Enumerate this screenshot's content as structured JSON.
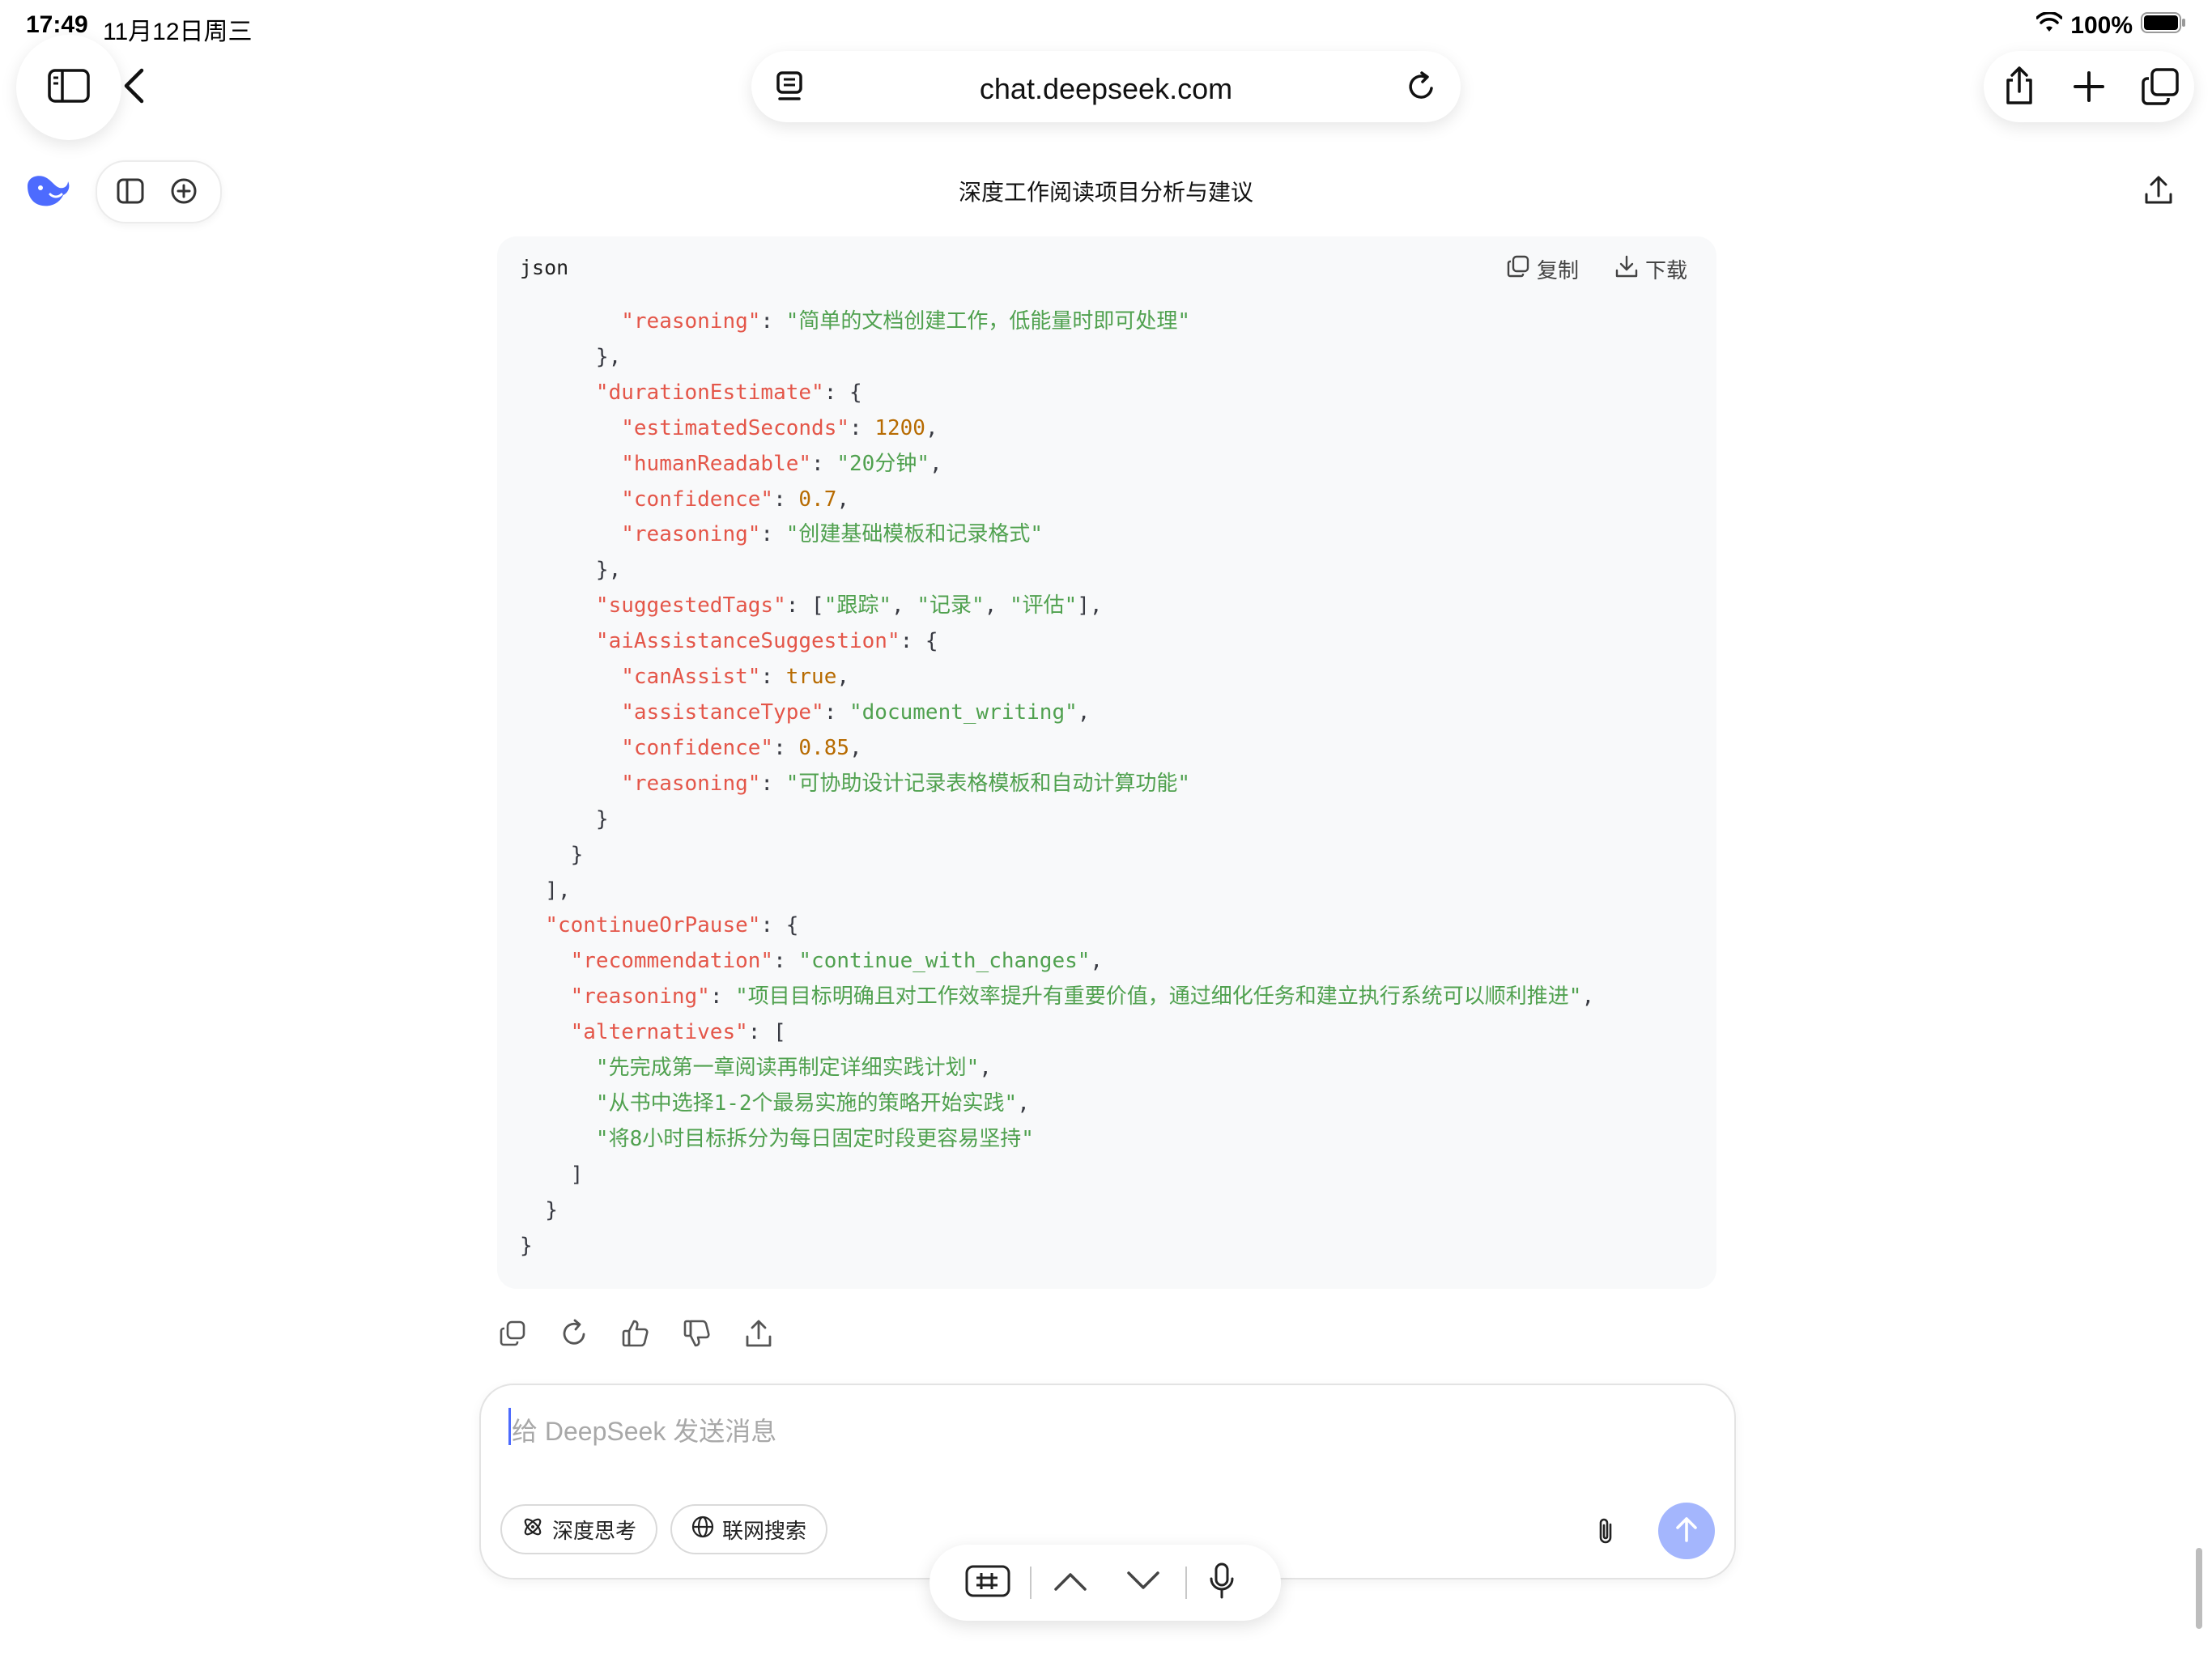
{
  "status_bar": {
    "time": "17:49",
    "date": "11月12日周三",
    "battery": "100%"
  },
  "browser": {
    "url": "chat.deepseek.com"
  },
  "chat": {
    "title": "深度工作阅读项目分析与建议"
  },
  "code_block": {
    "language": "json",
    "copy_label": "复制",
    "download_label": "下载",
    "lines": [
      [
        [
          "        ",
          "p"
        ],
        [
          "\"reasoning\"",
          "k"
        ],
        [
          ": ",
          "p"
        ],
        [
          "\"简单的文档创建工作，低能量时即可处理\"",
          "s"
        ]
      ],
      [
        [
          "      },",
          "p"
        ]
      ],
      [
        [
          "      ",
          "p"
        ],
        [
          "\"durationEstimate\"",
          "k"
        ],
        [
          ": {",
          "p"
        ]
      ],
      [
        [
          "        ",
          "p"
        ],
        [
          "\"estimatedSeconds\"",
          "k"
        ],
        [
          ": ",
          "p"
        ],
        [
          "1200",
          "n"
        ],
        [
          ",",
          "p"
        ]
      ],
      [
        [
          "        ",
          "p"
        ],
        [
          "\"humanReadable\"",
          "k"
        ],
        [
          ": ",
          "p"
        ],
        [
          "\"20分钟\"",
          "s"
        ],
        [
          ",",
          "p"
        ]
      ],
      [
        [
          "        ",
          "p"
        ],
        [
          "\"confidence\"",
          "k"
        ],
        [
          ": ",
          "p"
        ],
        [
          "0.7",
          "n"
        ],
        [
          ",",
          "p"
        ]
      ],
      [
        [
          "        ",
          "p"
        ],
        [
          "\"reasoning\"",
          "k"
        ],
        [
          ": ",
          "p"
        ],
        [
          "\"创建基础模板和记录格式\"",
          "s"
        ]
      ],
      [
        [
          "      },",
          "p"
        ]
      ],
      [
        [
          "      ",
          "p"
        ],
        [
          "\"suggestedTags\"",
          "k"
        ],
        [
          ": [",
          "p"
        ],
        [
          "\"跟踪\"",
          "s"
        ],
        [
          ", ",
          "p"
        ],
        [
          "\"记录\"",
          "s"
        ],
        [
          ", ",
          "p"
        ],
        [
          "\"评估\"",
          "s"
        ],
        [
          "],",
          "p"
        ]
      ],
      [
        [
          "      ",
          "p"
        ],
        [
          "\"aiAssistanceSuggestion\"",
          "k"
        ],
        [
          ": {",
          "p"
        ]
      ],
      [
        [
          "        ",
          "p"
        ],
        [
          "\"canAssist\"",
          "k"
        ],
        [
          ": ",
          "p"
        ],
        [
          "true",
          "n"
        ],
        [
          ",",
          "p"
        ]
      ],
      [
        [
          "        ",
          "p"
        ],
        [
          "\"assistanceType\"",
          "k"
        ],
        [
          ": ",
          "p"
        ],
        [
          "\"document_writing\"",
          "s"
        ],
        [
          ",",
          "p"
        ]
      ],
      [
        [
          "        ",
          "p"
        ],
        [
          "\"confidence\"",
          "k"
        ],
        [
          ": ",
          "p"
        ],
        [
          "0.85",
          "n"
        ],
        [
          ",",
          "p"
        ]
      ],
      [
        [
          "        ",
          "p"
        ],
        [
          "\"reasoning\"",
          "k"
        ],
        [
          ": ",
          "p"
        ],
        [
          "\"可协助设计记录表格模板和自动计算功能\"",
          "s"
        ]
      ],
      [
        [
          "      }",
          "p"
        ]
      ],
      [
        [
          "    }",
          "p"
        ]
      ],
      [
        [
          "  ],",
          "p"
        ]
      ],
      [
        [
          "  ",
          "p"
        ],
        [
          "\"continueOrPause\"",
          "k"
        ],
        [
          ": {",
          "p"
        ]
      ],
      [
        [
          "    ",
          "p"
        ],
        [
          "\"recommendation\"",
          "k"
        ],
        [
          ": ",
          "p"
        ],
        [
          "\"continue_with_changes\"",
          "s"
        ],
        [
          ",",
          "p"
        ]
      ],
      [
        [
          "    ",
          "p"
        ],
        [
          "\"reasoning\"",
          "k"
        ],
        [
          ": ",
          "p"
        ],
        [
          "\"项目目标明确且对工作效率提升有重要价值，通过细化任务和建立执行系统可以顺利推进\"",
          "s"
        ],
        [
          ",",
          "p"
        ]
      ],
      [
        [
          "    ",
          "p"
        ],
        [
          "\"alternatives\"",
          "k"
        ],
        [
          ": [",
          "p"
        ]
      ],
      [
        [
          "      ",
          "p"
        ],
        [
          "\"先完成第一章阅读再制定详细实践计划\"",
          "s"
        ],
        [
          ",",
          "p"
        ]
      ],
      [
        [
          "      ",
          "p"
        ],
        [
          "\"从书中选择1-2个最易实施的策略开始实践\"",
          "s"
        ],
        [
          ",",
          "p"
        ]
      ],
      [
        [
          "      ",
          "p"
        ],
        [
          "\"将8小时目标拆分为每日固定时段更容易坚持\"",
          "s"
        ]
      ],
      [
        [
          "    ]",
          "p"
        ]
      ],
      [
        [
          "  }",
          "p"
        ]
      ],
      [
        [
          "}",
          "p"
        ]
      ]
    ]
  },
  "composer": {
    "placeholder": "给 DeepSeek 发送消息",
    "deep_think_label": "深度思考",
    "web_search_label": "联网搜索"
  },
  "colors": {
    "accent": "#4d6bfe",
    "send_disabled": "#a4b6fd",
    "json_key": "#e45649",
    "json_string": "#50a14f",
    "json_number": "#b76b01"
  }
}
